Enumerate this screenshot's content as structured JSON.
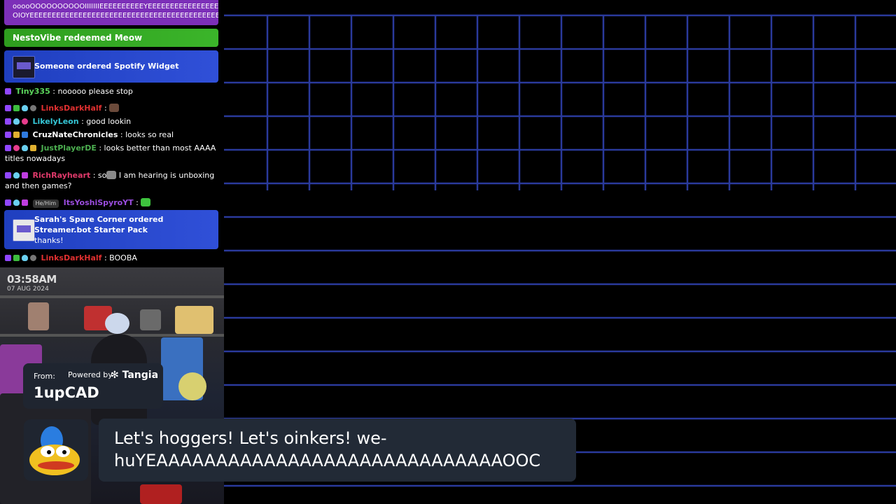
{
  "chat": {
    "top_banner": {
      "line1": "ooooOOOOOOOOOOIIIIIIIEEEEEEEEEEYEEEEEEEEEEEEEEEE",
      "line2": "OIOYEEEEEEEEEEEEEEEEEEEEEEEEEEEEEEEEEEEEEEEEEEEEEE"
    },
    "redeem_banner": "NestoVibe redeemed Meow",
    "order1": "Someone ordered Spotify Widget",
    "messages": [
      {
        "user": "Tiny335",
        "color": "#5cd65c",
        "text": ": nooooo please stop"
      },
      {
        "user": "LinksDarkHalf",
        "color": "#e03030",
        "text": ":"
      },
      {
        "user": "LikelyLeon",
        "color": "#35c6d6",
        "text": ": good lookin"
      },
      {
        "user": "CruzNateChronicles",
        "color": "#ffffff",
        "text": ": looks so real"
      },
      {
        "user": "JustPlayerDE",
        "color": "#4caf50",
        "text": ": looks better than most AAAA titles nowadays"
      },
      {
        "user": "RichRayheart",
        "color": "#e03a6b",
        "text": ": so",
        "text2": " I am hearing is unboxing and then games?"
      },
      {
        "user": "ItsYoshiSpyroYT",
        "color": "#9b4de0",
        "text": ":",
        "pronoun": "He/Him"
      }
    ],
    "order2": {
      "title": "Sarah's Spare Corner ordered Streamer.bot Starter Pack",
      "message": "thanks!"
    },
    "last_message": {
      "user": "LinksDarkHalf",
      "color": "#e03030",
      "text": ": BOOBA"
    }
  },
  "webcam": {
    "time": "03:58AM",
    "date": "07 AUG 2024"
  },
  "tangia": {
    "from_label": "From:",
    "powered_label": "Powered by",
    "brand": "Tangia",
    "donor": "1upCAD",
    "message": "Let's hoggers! Let's oinkers! we-\nhuYEAAAAAAAAAAAAAAAAAAAAAAAAAAAAAOOC"
  },
  "colors": {
    "grid_line": "#2a3a9c",
    "order_card": "#2a48d0",
    "redeem_banner": "#35a824",
    "top_banner": "#7c2fb8"
  }
}
